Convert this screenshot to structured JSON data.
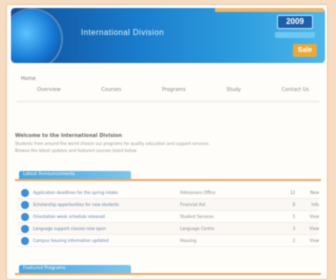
{
  "header": {
    "title": "International Division",
    "badge": "2009",
    "badge_sub": "",
    "sale": "Sale"
  },
  "nav": {
    "home": "Home",
    "items": [
      "Overview",
      "Courses",
      "Programs",
      "Study",
      "Contact Us"
    ]
  },
  "intro": {
    "title": "Welcome to the International Division",
    "lines": [
      "Students from around the world choose our programs for quality education and support services.",
      "Browse the latest updates and featured courses listed below."
    ]
  },
  "sections": [
    {
      "label": "Latest Announcements"
    },
    {
      "label": "Featured Programs"
    }
  ],
  "table": {
    "rows": [
      {
        "name": "Application deadlines for the spring intake",
        "mid": "Admissions Office",
        "num": "12",
        "last": "New"
      },
      {
        "name": "Scholarship opportunities for new students",
        "mid": "Financial Aid",
        "num": "8",
        "last": "Info"
      },
      {
        "name": "Orientation week schedule released",
        "mid": "Student Services",
        "num": "5",
        "last": "View"
      },
      {
        "name": "Language support classes now open",
        "mid": "Language Centre",
        "num": "3",
        "last": "View"
      },
      {
        "name": "Campus housing information updated",
        "mid": "Housing",
        "num": "2",
        "last": "View"
      }
    ]
  },
  "colors": {
    "banner_start": "#0f4f98",
    "banner_end": "#4fb7ea",
    "accent_orange": "#f0a868"
  }
}
